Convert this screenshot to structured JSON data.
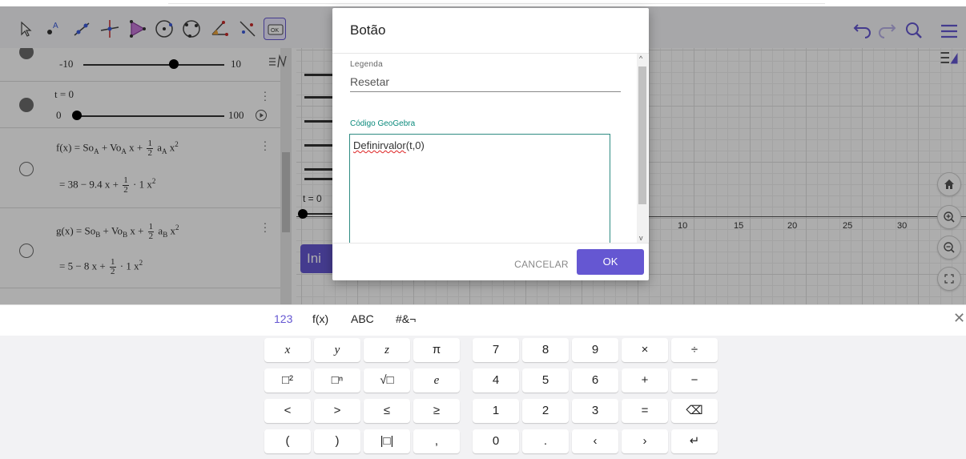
{
  "toolbar": {
    "tools": [
      "move-tool-icon",
      "point-tool-icon",
      "line-tool-icon",
      "perpendicular-tool-icon",
      "polygon-tool-icon",
      "circle-tool-icon",
      "circle-three-points-tool-icon",
      "angle-tool-icon",
      "reflect-tool-icon",
      "button-tool-icon"
    ],
    "button_tool_label": "OK"
  },
  "algebra": {
    "row1": {
      "min": "-10",
      "max": "10",
      "value_fraction": 0.64
    },
    "row2": {
      "label": "t = 0",
      "min": "0",
      "max": "100",
      "value_fraction": 0.0
    },
    "row3": {
      "def_prefix": "f(x)  =  So",
      "sub_A": "A",
      "plus_vo": " + Vo",
      "x_plus": " x + ",
      "a_A": " a",
      "x2": " x",
      "result_prefix": "=  38 − 9.4 x + ",
      "result_suffix": " · 1 x",
      "frac_num": "1",
      "frac_den": "2",
      "sq": "2"
    },
    "row4": {
      "def_prefix": "g(x)  =  So",
      "sub_B": "B",
      "plus_vo": " + Vo",
      "x_plus": " x + ",
      "a_B": " a",
      "x2": " x",
      "result_prefix": "=  5 − 8 x + ",
      "result_suffix": " · 1 x",
      "frac_num": "1",
      "frac_den": "2",
      "sq": "2"
    }
  },
  "graphics": {
    "slider_label": "t = 0",
    "button_partial": "Ini",
    "x_ticks": [
      "10",
      "15",
      "20",
      "25",
      "30"
    ]
  },
  "dialog": {
    "title": "Botão",
    "caption_label": "Legenda",
    "caption_value": "Resetar",
    "code_label": "Código GeoGebra",
    "code_word": "Definirvalor",
    "code_rest": "(t,0)",
    "cancel_label": "CANCELAR",
    "ok_label": "OK"
  },
  "keyboard": {
    "tabs": [
      "123",
      "f(x)",
      "ABC",
      "#&¬"
    ],
    "active_tab": "123",
    "row1": [
      "x",
      "y",
      "z",
      "π",
      "7",
      "8",
      "9",
      "×",
      "÷"
    ],
    "row2": [
      "□²",
      "□ⁿ",
      "√□",
      "e",
      "4",
      "5",
      "6",
      "+",
      "−"
    ],
    "row3": [
      "<",
      ">",
      "≤",
      "≥",
      "1",
      "2",
      "3",
      "=",
      "⌫"
    ],
    "row4": [
      "(",
      ")",
      "|□|",
      ",",
      "0",
      ".",
      "‹",
      "›",
      "↵"
    ]
  },
  "colors": {
    "accent": "#6557d2",
    "code_label": "#0b8a7c"
  }
}
